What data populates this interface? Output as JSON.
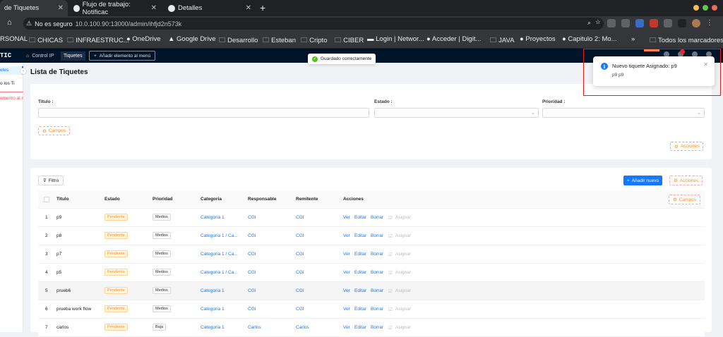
{
  "browser": {
    "tabs": [
      {
        "title": "de Tiquetes"
      },
      {
        "title": "Flujo de trabajo: Notificac"
      },
      {
        "title": "Detalles"
      }
    ],
    "address": {
      "security": "No es seguro",
      "url": "10.0.100.90:13000/admin/ihfjd2n573k"
    },
    "bookmarks": [
      "RSONAL",
      "CHICAS",
      "INFRAESTRUC...",
      "OneDrive",
      "Google Drive",
      "Desarrollo",
      "Esteban",
      "Cripto",
      "CIBER",
      "Login | Networ...",
      "Acceder | Digit...",
      "JAVA",
      "Proyectos",
      "Capitulo 2: Mo...",
      "»",
      "Todos los marcadores"
    ]
  },
  "app": {
    "logo": "TIC",
    "menu": [
      "Control IP",
      "Tiquetes"
    ],
    "add_menu": "Añadir elemento al menú",
    "sidebar": [
      "etes",
      "o los Ti",
      "emento al m"
    ]
  },
  "toast": {
    "text": "Guardado correctamente"
  },
  "notification": {
    "title": "Nuevo tiquete Asignado: p9",
    "body": "p9 p9"
  },
  "page": {
    "title": "Lista de Tiquetes",
    "form": {
      "titulo_label": "Titulo :",
      "estado_label": "Estado :",
      "prioridad_label": "Prioridad :",
      "campos": "Campos",
      "acciones": "Acciones"
    },
    "table_toolbar": {
      "filter": "Filtro",
      "add_new": "Añadir nuevo",
      "acciones": "Acciones",
      "campos": "Campos"
    },
    "columns": [
      "Titulo",
      "Estado",
      "Prioridad",
      "Categoria",
      "Responsable",
      "Remitente",
      "Acciones"
    ],
    "actions": [
      "Ver",
      "Editar",
      "Borrar",
      "Asignar"
    ],
    "rows": [
      {
        "n": "1",
        "titulo": "p9",
        "estado": "Pendiente",
        "prioridad": "Medios",
        "categoria": "Categoria 1",
        "responsable": "CGI",
        "remitente": "CGI"
      },
      {
        "n": "2",
        "titulo": "p8",
        "estado": "Pendiente",
        "prioridad": "Medios",
        "categoria": "Categoria 1 / Ca...",
        "responsable": "CGI",
        "remitente": "CGI"
      },
      {
        "n": "3",
        "titulo": "p7",
        "estado": "Pendiente",
        "prioridad": "Medios",
        "categoria": "Categoria 1 / Ca...",
        "responsable": "CGI",
        "remitente": "CGI"
      },
      {
        "n": "4",
        "titulo": "p5",
        "estado": "Pendiente",
        "prioridad": "Medios",
        "categoria": "Categoria 1 / Ca...",
        "responsable": "CGI",
        "remitente": "CGI"
      },
      {
        "n": "5",
        "titulo": "prueb6",
        "estado": "Pendiente",
        "prioridad": "Medios",
        "categoria": "Categoria 1",
        "responsable": "CGI",
        "remitente": "CGI"
      },
      {
        "n": "6",
        "titulo": "prueba work flow",
        "estado": "Pendiente",
        "prioridad": "Medios",
        "categoria": "Categoria 1",
        "responsable": "CGI",
        "remitente": "CGI"
      },
      {
        "n": "7",
        "titulo": "carlos",
        "estado": "Pendiente",
        "prioridad": "Baja",
        "categoria": "Categoria 1",
        "responsable": "Carlos",
        "remitente": "Carlos"
      }
    ]
  }
}
